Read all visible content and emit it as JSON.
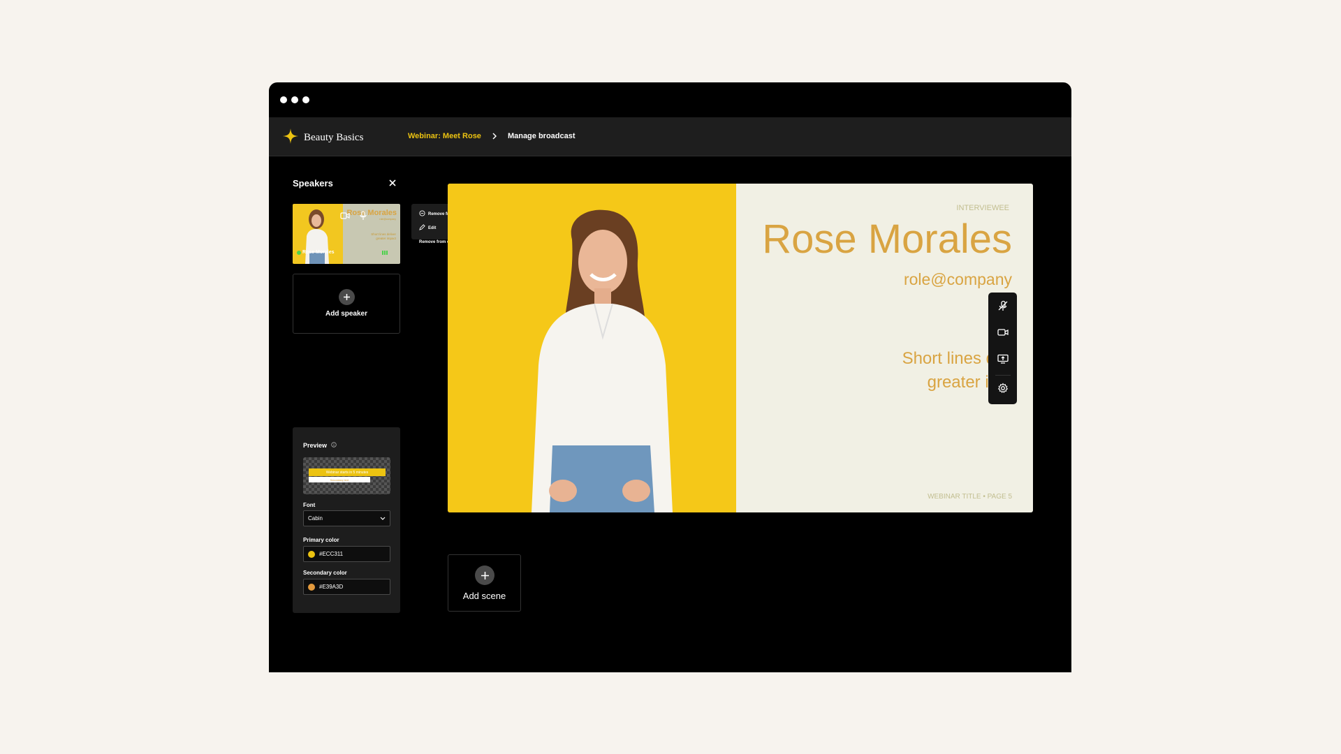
{
  "app": {
    "brand": "Beauty Basics",
    "accent_color": "#ecc311"
  },
  "breadcrumb": {
    "items": [
      "Webinar: Meet Rose",
      "Manage broadcast"
    ]
  },
  "speakers_panel": {
    "title": "Speakers",
    "speaker_card": {
      "thumbnail_name": "Rose Morales",
      "label": "Rose Morales"
    },
    "add_speaker": "Add speaker"
  },
  "context_menu": {
    "items": [
      "Remove from scene",
      "Edit",
      "Remove from event"
    ]
  },
  "preview_panel": {
    "title": "Preview",
    "banner_primary": "Webinar starts in 5 minutes",
    "banner_secondary": "Secondary text",
    "font_label": "Font",
    "font_value": "Cabin",
    "primary_color_label": "Primary color",
    "primary_color_value": "#ECC311",
    "primary_color": "#ECC311",
    "secondary_color_label": "Secondary color",
    "secondary_color_value": "#E39A3D",
    "secondary_color": "#E39A3D"
  },
  "scene": {
    "kicker": "INTERVIEWEE",
    "name": "Rose Morales",
    "role": "role@company",
    "quote_line1": "Short lines deli",
    "quote_line2": "greater imp",
    "footer": "WEBINAR TITLE • PAGE 5",
    "photo_bg": "#f5c818",
    "text_color": "#d9a442"
  },
  "toolbar": {
    "icons": [
      "mic-off-icon",
      "camera-icon",
      "screen-share-icon",
      "settings-icon"
    ]
  },
  "add_scene": "Add scene"
}
